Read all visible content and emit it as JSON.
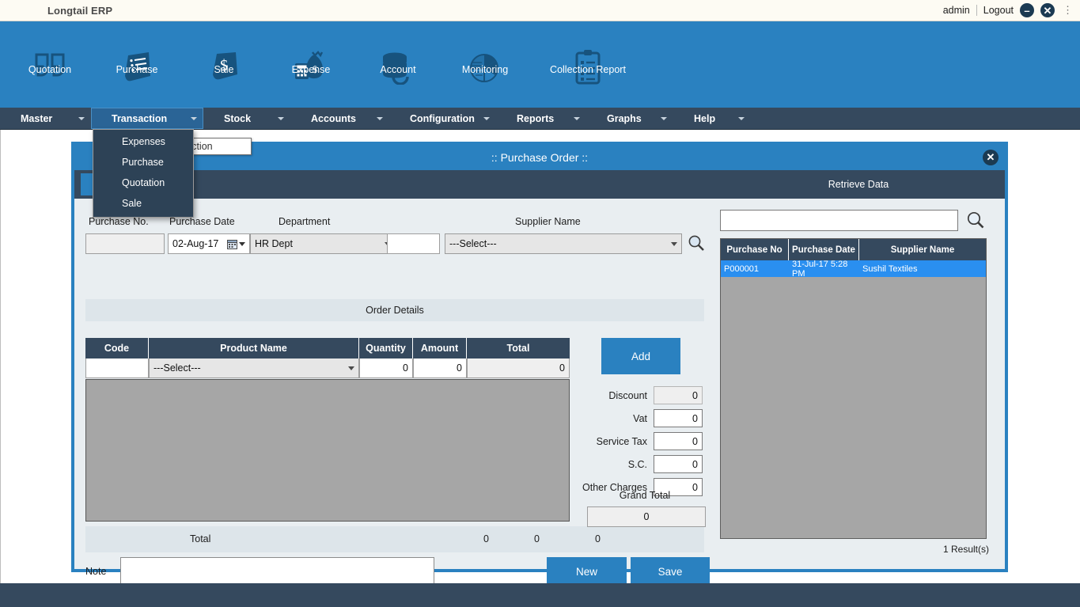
{
  "titlebar": {
    "app_name": "Longtail ERP",
    "user": "admin",
    "logout": "Logout",
    "minimize_icon": "minimize-icon",
    "close_icon": "close-icon",
    "menu_dots_icon": "vertical-dots-icon"
  },
  "ribbon": {
    "items": [
      {
        "label": "Quotation",
        "icon": "quotation-icon"
      },
      {
        "label": "Purchase",
        "icon": "purchase-document-icon"
      },
      {
        "label": "Sale",
        "icon": "sale-dollar-icon"
      },
      {
        "label": "Expense",
        "icon": "expense-moneybag-icon"
      },
      {
        "label": "Account",
        "icon": "account-database-icon"
      },
      {
        "label": "Monitoring",
        "icon": "monitoring-piechart-icon"
      },
      {
        "label": "Collection Report",
        "icon": "collection-report-clipboard-icon"
      }
    ]
  },
  "menubar": {
    "items": [
      {
        "label": "Master",
        "active": false
      },
      {
        "label": "Transaction",
        "active": true
      },
      {
        "label": "Stock",
        "active": false
      },
      {
        "label": "Accounts",
        "active": false
      },
      {
        "label": "Configuration",
        "active": false
      },
      {
        "label": "Reports",
        "active": false
      },
      {
        "label": "Graphs",
        "active": false
      },
      {
        "label": "Help",
        "active": false
      }
    ]
  },
  "dropdown": {
    "open_for": "Transaction",
    "items": [
      "Expenses",
      "Purchase",
      "Quotation",
      "Sale"
    ]
  },
  "tooltip": {
    "text": "saction"
  },
  "dialog": {
    "title": ":: Purchase Order ::",
    "close_icon": "close-icon",
    "form": {
      "purchase_no": {
        "label": "Purchase No.",
        "value": ""
      },
      "purchase_date": {
        "label": "Purchase Date",
        "value": "02-Aug-17",
        "calendar_icon": "calendar-icon"
      },
      "department": {
        "label": "Department",
        "value": "HR Dept"
      },
      "supplier_code": {
        "value": ""
      },
      "supplier_name": {
        "label": "Supplier Name",
        "value": "---Select---",
        "search_icon": "magnifier-icon"
      }
    },
    "order_details": {
      "section_title": "Order Details",
      "columns": [
        "Code",
        "Product Name",
        "Quantity",
        "Amount",
        "Total"
      ],
      "entry_row": {
        "code": "",
        "product_name": "---Select---",
        "quantity": "0",
        "amount": "0",
        "total": "0"
      },
      "rows": [],
      "footer": {
        "label": "Total",
        "quantity": "0",
        "amount": "0",
        "total": "0"
      }
    },
    "add_button": "Add",
    "charges": [
      {
        "label": "Discount",
        "value": "0",
        "readonly": true
      },
      {
        "label": "Vat",
        "value": "0",
        "readonly": false
      },
      {
        "label": "Service Tax",
        "value": "0",
        "readonly": false
      },
      {
        "label": "S.C.",
        "value": "0",
        "readonly": false
      },
      {
        "label": "Other Charges",
        "value": "0",
        "readonly": false
      }
    ],
    "grand_total": {
      "label": "Grand Total",
      "value": "0"
    },
    "note": {
      "label": "Note",
      "value": ""
    },
    "new_button": "New",
    "save_button": "Save"
  },
  "retrieve": {
    "header": "Retrieve Data",
    "search_value": "",
    "search_icon": "magnifier-icon",
    "columns": [
      "Purchase No",
      "Purchase Date",
      "Supplier Name"
    ],
    "rows": [
      {
        "purchase_no": "P000001",
        "purchase_date": "31-Jul-17 5:28 PM",
        "supplier_name": "Sushil Textiles",
        "selected": true
      }
    ],
    "result_count": "1 Result(s)"
  },
  "colors": {
    "ribbon_blue": "#2a81c0",
    "menu_dark": "#35495e",
    "panel_bg": "#e9eef1",
    "grid_empty": "#a6a6a6",
    "row_selected": "#2a8ff0",
    "title_bg": "#fdfbf3"
  }
}
